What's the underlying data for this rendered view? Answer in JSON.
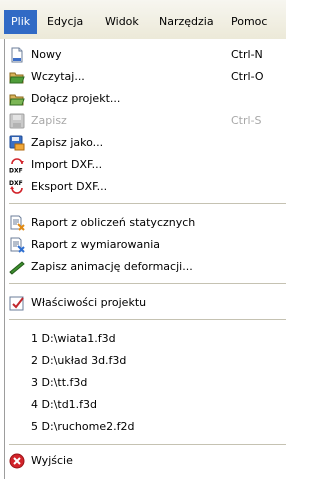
{
  "menubar": {
    "items": [
      {
        "label": "Plik"
      },
      {
        "label": "Edycja"
      },
      {
        "label": "Widok"
      },
      {
        "label": "Narzędzia"
      },
      {
        "label": "Pomoc"
      }
    ]
  },
  "file_menu": {
    "group1": [
      {
        "label": "Nowy",
        "shortcut": "Ctrl-N",
        "icon": "new-document-icon"
      },
      {
        "label": "Wczytaj...",
        "shortcut": "Ctrl-O",
        "icon": "open-folder-icon"
      },
      {
        "label": "Dołącz projekt...",
        "shortcut": "",
        "icon": "attach-project-icon"
      },
      {
        "label": "Zapisz",
        "shortcut": "Ctrl-S",
        "icon": "save-icon",
        "disabled": true
      },
      {
        "label": "Zapisz jako...",
        "shortcut": "",
        "icon": "save-as-icon"
      },
      {
        "label": "Import DXF...",
        "shortcut": "",
        "icon": "import-dxf-icon"
      },
      {
        "label": "Eksport DXF...",
        "shortcut": "",
        "icon": "export-dxf-icon"
      }
    ],
    "group2": [
      {
        "label": "Raport z obliczeń statycznych",
        "icon": "report-statics-icon"
      },
      {
        "label": "Raport z wymiarowania",
        "icon": "report-dimensioning-icon"
      },
      {
        "label": "Zapisz animację deformacji...",
        "icon": "save-animation-icon"
      }
    ],
    "group3": [
      {
        "label": "Właściwości projektu",
        "icon": "project-properties-icon"
      }
    ],
    "recent_files": [
      "1 D:\\wiata1.f3d",
      "2 D:\\układ 3d.f3d",
      "3 D:\\tt.f3d",
      "4 D:\\td1.f3d",
      "5 D:\\ruchome2.f2d"
    ],
    "exit": {
      "label": "Wyjście",
      "icon": "exit-icon"
    }
  }
}
